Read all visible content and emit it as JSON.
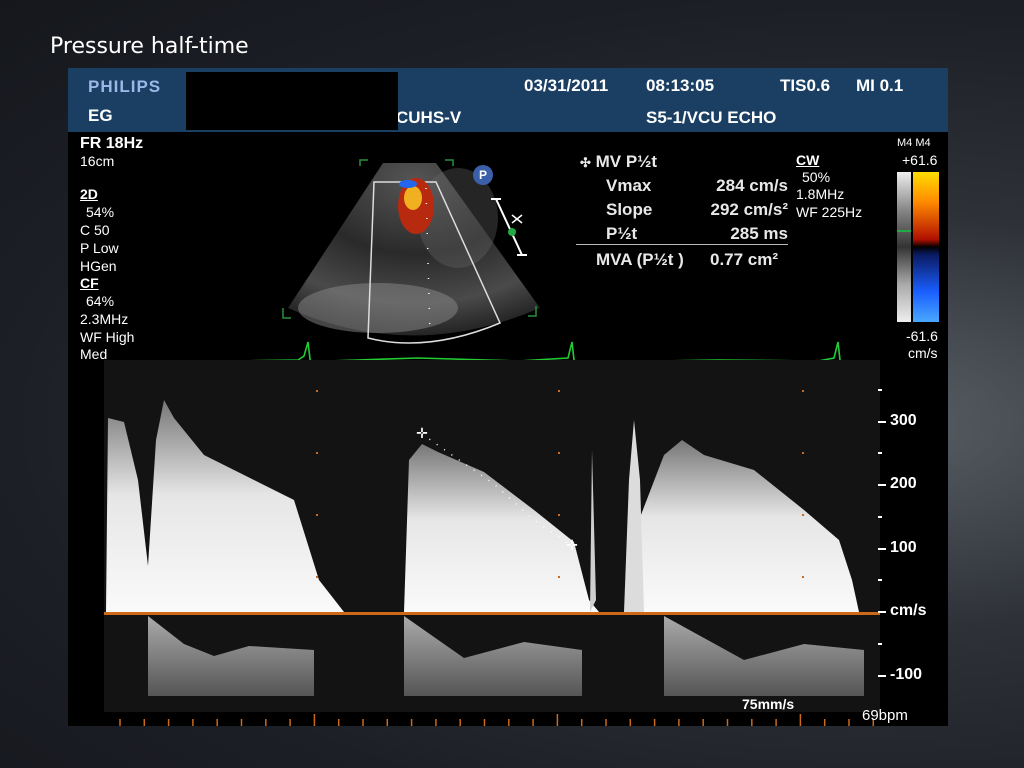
{
  "slide": {
    "title": "Pressure half-time"
  },
  "header": {
    "brand": "PHILIPS",
    "site_prefix": "EG",
    "site_suffix": "CUHS-V",
    "date": "03/31/2011",
    "time": "08:13:05",
    "tis": "TIS0.6",
    "mi": "MI 0.1",
    "probe": "S5-1/VCU ECHO"
  },
  "left_panel": {
    "fr": "FR 18Hz",
    "depth": "16cm",
    "mode_2d": "2D",
    "gain_2d": "54%",
    "compress": "C 50",
    "power": "P Low",
    "freq_mode": "HGen",
    "mode_cf": "CF",
    "gain_cf": "64%",
    "cf_freq": "2.3MHz",
    "cf_filter": "WF High",
    "cf_scale": "Med"
  },
  "measurements": {
    "title": "MV P½t",
    "rows": [
      {
        "label": "Vmax",
        "value": "284 cm/s"
      },
      {
        "label": "Slope",
        "value": "292 cm/s²"
      },
      {
        "label": "P½t",
        "value": "285 ms"
      }
    ],
    "mva_label": "MVA (P½t )",
    "mva_value": "0.77 cm²"
  },
  "cw_panel": {
    "mode": "CW",
    "gain": "50%",
    "freq": "1.8MHz",
    "filter": "WF 225Hz"
  },
  "color_scale": {
    "label": "M4 M4",
    "top": "+61.6",
    "bottom": "-61.6",
    "unit": "cm/s",
    "colors": {
      "positive": "#ffdd00",
      "mid": "#b01000",
      "negative": "#1a5fff"
    }
  },
  "probe_marker": "P",
  "doppler_scale": {
    "labels": [
      "300",
      "200",
      "100",
      "cm/s",
      "-100"
    ],
    "values": [
      300,
      200,
      100,
      0,
      -100
    ]
  },
  "sweep_speed": "75mm/s",
  "heart_rate": "69bpm",
  "colors": {
    "header_bg": "#1b3f63",
    "ecg": "#22cc33",
    "baseline": "#cc6a1a",
    "sector_outline": "#2a8f3a"
  }
}
